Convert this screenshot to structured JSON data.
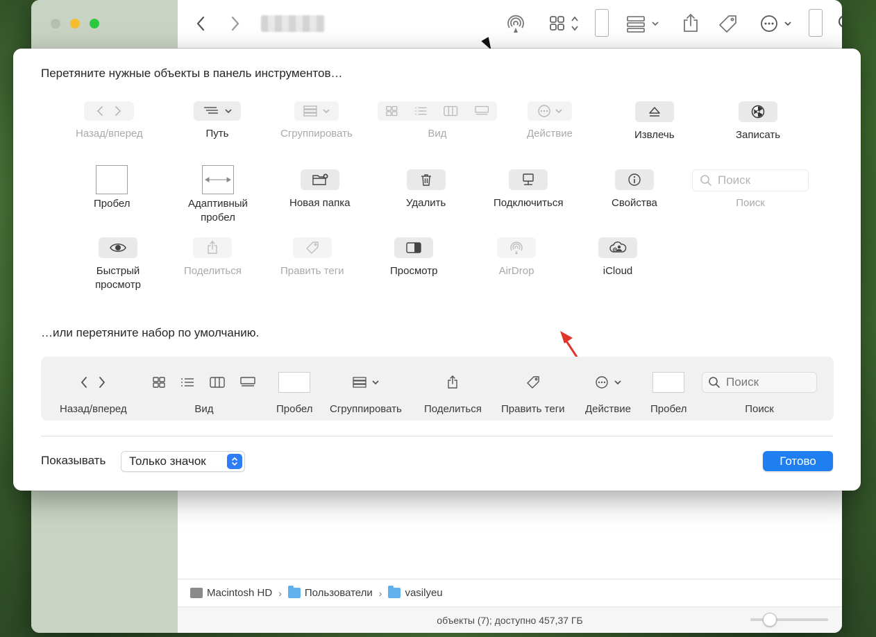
{
  "finder": {
    "status": "объекты (7); доступно 457,37 ГБ",
    "path": [
      {
        "label": "Macintosh HD",
        "icon": "hard-drive-icon"
      },
      {
        "label": "Пользователи",
        "icon": "folder-icon"
      },
      {
        "label": "vasilyeu",
        "icon": "home-folder-icon"
      }
    ]
  },
  "sheet": {
    "title": "Перетяните нужные объекты в панель инструментов…",
    "palette": [
      {
        "label": "Назад/вперед",
        "icon": "back-forward-icon",
        "enabled": false
      },
      {
        "label": "Путь",
        "icon": "path-icon",
        "enabled": true
      },
      {
        "label": "Сгруппировать",
        "icon": "group-icon",
        "enabled": false
      },
      {
        "label": "Вид",
        "icon": "view-icon",
        "enabled": false
      },
      {
        "label": "Действие",
        "icon": "action-icon",
        "enabled": false
      },
      {
        "label": "Извлечь",
        "icon": "eject-icon",
        "enabled": true
      },
      {
        "label": "Записать",
        "icon": "burn-icon",
        "enabled": true
      },
      {
        "label": "Пробел",
        "icon": "space-icon",
        "enabled": true
      },
      {
        "label": "Адаптивный пробел",
        "icon": "flexible-space-icon",
        "enabled": true
      },
      {
        "label": "Новая папка",
        "icon": "new-folder-icon",
        "enabled": true
      },
      {
        "label": "Удалить",
        "icon": "trash-icon",
        "enabled": true
      },
      {
        "label": "Подключиться",
        "icon": "connect-icon",
        "enabled": true
      },
      {
        "label": "Свойства",
        "icon": "info-icon",
        "enabled": true
      },
      {
        "label": "Поиск",
        "icon": "search-icon",
        "enabled": false,
        "placeholder": "Поиск"
      },
      {
        "label": "Быстрый просмотр",
        "icon": "quick-look-icon",
        "enabled": true
      },
      {
        "label": "Поделиться",
        "icon": "share-icon",
        "enabled": false
      },
      {
        "label": "Править теги",
        "icon": "tag-icon",
        "enabled": false
      },
      {
        "label": "Просмотр",
        "icon": "preview-pane-icon",
        "enabled": true
      },
      {
        "label": "AirDrop",
        "icon": "airdrop-icon",
        "enabled": false
      },
      {
        "label": "iCloud",
        "icon": "icloud-icon",
        "enabled": true
      }
    ],
    "default_title": "…или перетяните набор по умолчанию.",
    "default_set": [
      {
        "label": "Назад/вперед"
      },
      {
        "label": "Вид"
      },
      {
        "label": "Пробел"
      },
      {
        "label": "Сгруппировать"
      },
      {
        "label": "Поделиться"
      },
      {
        "label": "Править теги"
      },
      {
        "label": "Действие"
      },
      {
        "label": "Пробел"
      },
      {
        "label": "Поиск",
        "placeholder": "Поиск"
      }
    ],
    "show_label": "Показывать",
    "show_value": "Только значок",
    "done_label": "Готово"
  },
  "colors": {
    "accent": "#1f7ff0",
    "annotation_arrow": "#e0342b"
  }
}
